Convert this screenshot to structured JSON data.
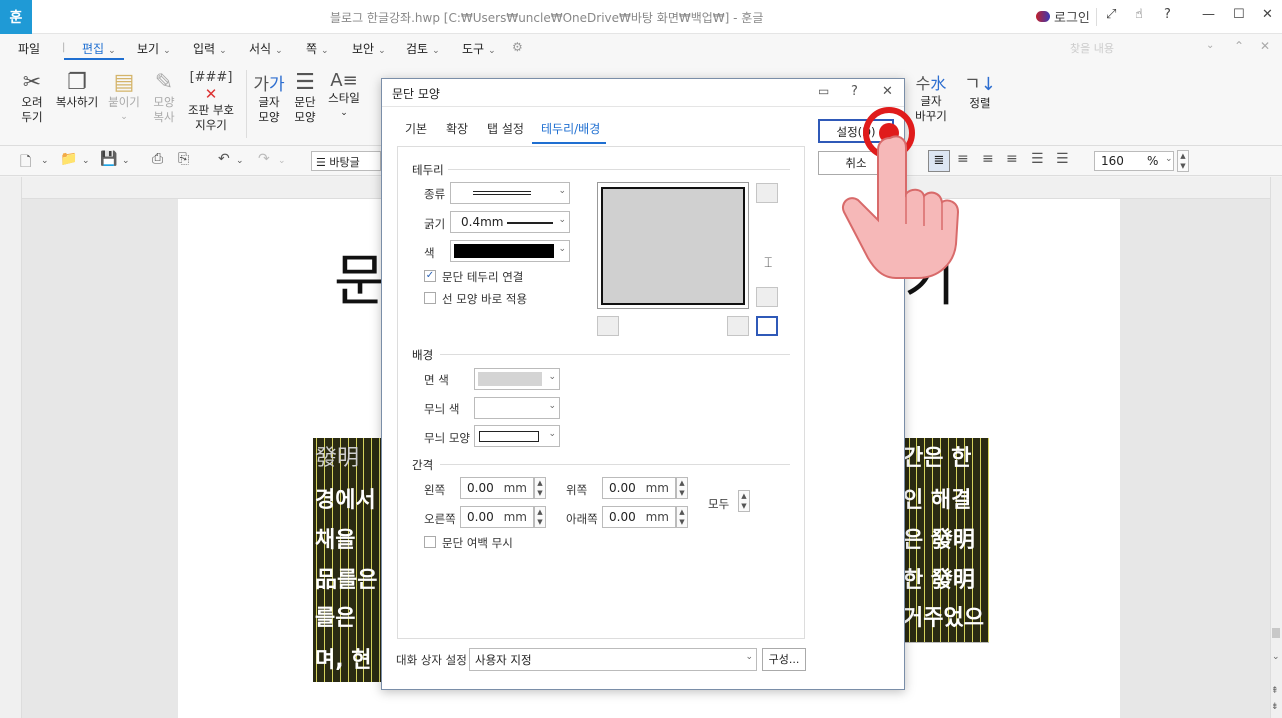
{
  "window": {
    "title": "블로그 한글강좌.hwp [C:₩Users₩uncle₩OneDrive₩바탕 화면₩백업₩] - 훈글",
    "app_icon": "훈",
    "login_label": "로그인"
  },
  "menubar": {
    "items": [
      "파일",
      "편집",
      "보기",
      "입력",
      "서식",
      "쪽",
      "보안",
      "검토",
      "도구"
    ],
    "search_placeholder": "찾을 내용"
  },
  "ribbon": {
    "cut": [
      "오려",
      "두기"
    ],
    "copy": "복사하기",
    "paste": "붙이기",
    "copy_format": [
      "모양",
      "복사"
    ],
    "clear_format": [
      "조판 부호",
      "지우기"
    ],
    "char_shape": [
      "글자",
      "모양"
    ],
    "para_shape": [
      "문단",
      "모양"
    ],
    "style": "스타일",
    "change_char": [
      "글자",
      "바꾸기"
    ],
    "sort": "정렬"
  },
  "toolbar2": {
    "style_value": "바탕글",
    "zoom_value": "160",
    "zoom_unit": "%"
  },
  "document": {
    "title_left": "문",
    "title_right": "기",
    "lines": [
      "發明",
      "경에서",
      "채을",
      "品를은",
      "를은",
      "며, 현"
    ],
    "lines_right": [
      "간은 한",
      "인 해결",
      "은 發明",
      "한 發明",
      "거주었으",
      ""
    ]
  },
  "dialog": {
    "title": "문단 모양",
    "tabs": [
      "기본",
      "확장",
      "탭 설정",
      "테두리/배경"
    ],
    "active_tab": "테두리/배경",
    "ok_label": "설정(D)",
    "cancel_label": "취소",
    "border": {
      "section": "테두리",
      "type_label": "종류",
      "width_label": "굵기",
      "width_value": "0.4mm",
      "color_label": "색",
      "color_value": "#000000",
      "connect_label": "문단 테두리 연결",
      "connect_checked": true,
      "apply_label": "선 모양 바로 적용",
      "apply_checked": false
    },
    "background": {
      "section": "배경",
      "face_color_label": "면 색",
      "pattern_color_label": "무늬 색",
      "pattern_shape_label": "무늬 모양"
    },
    "spacing": {
      "section": "간격",
      "left_label": "왼쪽",
      "left_value": "0.00",
      "right_label": "오른쪽",
      "right_value": "0.00",
      "top_label": "위쪽",
      "top_value": "0.00",
      "bottom_label": "아래쪽",
      "bottom_value": "0.00",
      "all_label": "모두",
      "unit": "mm",
      "ignore_margin_label": "문단 여백 무시"
    },
    "preset_label": "대화 상자 설정",
    "preset_value": "사용자 지정",
    "config_label": "구성..."
  },
  "colors": {
    "accent": "#1f6fd1",
    "highlight_ring": "#e01b1b",
    "text_block_bg": "#2a2a12",
    "stripe": "#f3f06b"
  }
}
